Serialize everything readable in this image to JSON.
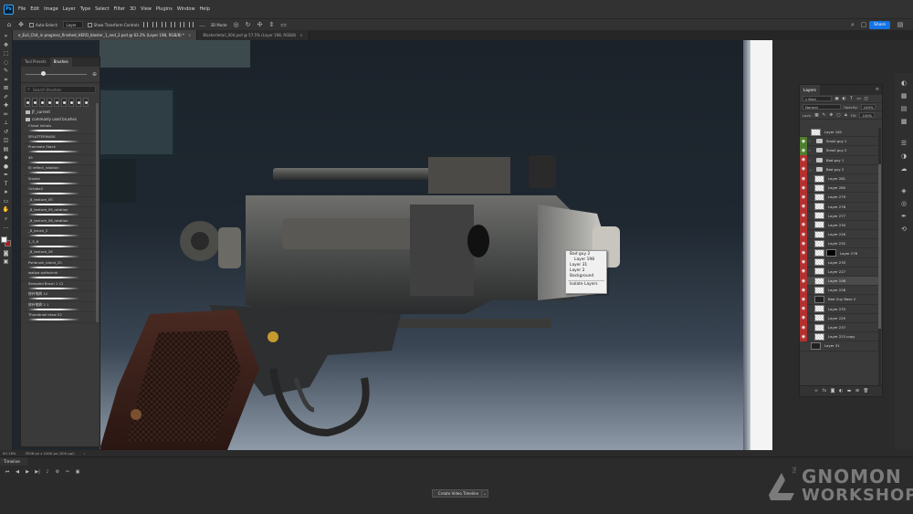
{
  "menubar": {
    "logo": "Ps",
    "items": [
      "File",
      "Edit",
      "Image",
      "Layer",
      "Type",
      "Select",
      "Filter",
      "3D",
      "View",
      "Plugins",
      "Window",
      "Help"
    ]
  },
  "options": {
    "auto_select_label": "Auto-Select:",
    "auto_select_value": "Layer",
    "transform_controls_label": "Show Transform Controls",
    "mode_3d_label": "3D Mode:",
    "share_label": "Share"
  },
  "tabs": [
    {
      "label": "e_Evil_Chit_in progress_finished_HERO_blaster_1_and_2.psd @ 63.2% (Layer 198, RGB/8) *",
      "active": true
    },
    {
      "label": "Blasterdetail_004.psd @ 57.5% (Layer 198, RGB/8)",
      "active": false
    }
  ],
  "brush_panel": {
    "tabs": [
      "Tool Presets",
      "Brushes"
    ],
    "search_placeholder": "Search Brushes",
    "folders": [
      "JF_current",
      "commonly used brushes"
    ],
    "brushes": [
      "Chisel Initials",
      "SPLATTERMASK",
      "Procreate Stack",
      "45",
      "EJ reflect_rotation",
      "Smoke",
      "Octoball",
      "_8_texture_05",
      "_8_texture_09_rotation",
      "_8_texture_06_rotation",
      "_8_brush_2",
      "1_5_8",
      "_8_texture_26",
      "Pshbrush_blend_20",
      "wallpa auftschnk",
      "Sampled Brush 1 12",
      "修补笔刷 12",
      "修补笔刷 2 1",
      "Thumbnail draw 02"
    ]
  },
  "context_menu": {
    "items": [
      "Bad guy 2",
      "Layer 198",
      "Layer 31",
      "Layer 2",
      "Background"
    ],
    "isolate_label": "Isolate Layers"
  },
  "layers_panel": {
    "tab_label": "Layers",
    "kind_label": "Kind",
    "blend_mode": "Normal",
    "opacity_label": "Opacity:",
    "opacity_value": "100%",
    "lock_label": "Lock:",
    "fill_label": "Fill:",
    "fill_value": "100%",
    "layers": [
      {
        "name": "Layer 162",
        "vis": "none",
        "kind": "layer",
        "indent": 0
      },
      {
        "name": "Small guy 1",
        "vis": "green",
        "kind": "folder",
        "indent": 0
      },
      {
        "name": "Small guy 2",
        "vis": "green",
        "kind": "folder",
        "indent": 0
      },
      {
        "name": "Bad guy 1",
        "vis": "red",
        "kind": "folder",
        "indent": 0
      },
      {
        "name": "Bad guy 2",
        "vis": "red",
        "kind": "folder",
        "indent": 0,
        "open": true
      },
      {
        "name": "Layer 281",
        "vis": "red",
        "kind": "layer",
        "indent": 1
      },
      {
        "name": "Layer 280",
        "vis": "red",
        "kind": "layer",
        "indent": 1
      },
      {
        "name": "Layer 279",
        "vis": "red",
        "kind": "layer",
        "indent": 1
      },
      {
        "name": "Layer 278",
        "vis": "red",
        "kind": "layer",
        "indent": 1
      },
      {
        "name": "Layer 277",
        "vis": "red",
        "kind": "layer",
        "indent": 1
      },
      {
        "name": "Layer 230",
        "vis": "red",
        "kind": "layer",
        "indent": 1
      },
      {
        "name": "Layer 226",
        "vis": "red",
        "kind": "layer",
        "indent": 1
      },
      {
        "name": "Layer 232",
        "vis": "red",
        "kind": "layer",
        "indent": 1
      },
      {
        "name": "Layer 278",
        "vis": "red",
        "kind": "mask",
        "indent": 1
      },
      {
        "name": "Layer 235",
        "vis": "red",
        "kind": "layer",
        "indent": 1
      },
      {
        "name": "Layer 227",
        "vis": "red",
        "kind": "layer",
        "indent": 1
      },
      {
        "name": "Layer 198",
        "vis": "red",
        "kind": "layer",
        "indent": 1,
        "selected": true
      },
      {
        "name": "Layer 228",
        "vis": "red",
        "kind": "layer",
        "indent": 1
      },
      {
        "name": "Bad Guy Base 2",
        "vis": "red",
        "kind": "dark",
        "indent": 1
      },
      {
        "name": "Layer 233",
        "vis": "red",
        "kind": "layer",
        "indent": 1
      },
      {
        "name": "Layer 229",
        "vis": "red",
        "kind": "layer",
        "indent": 1
      },
      {
        "name": "Layer 237",
        "vis": "red",
        "kind": "layer",
        "indent": 1
      },
      {
        "name": "Layer 223 copy",
        "vis": "red",
        "kind": "layer",
        "indent": 1
      },
      {
        "name": "Layer 31",
        "vis": "none",
        "kind": "dark",
        "indent": 0
      }
    ]
  },
  "statusbar": {
    "zoom": "63.18%",
    "doc_size": "3556 px x 2400 px (300 ppi)"
  },
  "timeline": {
    "title": "Timeline",
    "create_label": "Create Video Timeline"
  },
  "watermark": {
    "the": "THE",
    "line1": "GNOMON",
    "line2": "WORKSHOP"
  },
  "colors": {
    "accent": "#1473e6",
    "foreground_swatch": "#f2f2f2",
    "background_swatch": "#b01a1a",
    "layer_vis_red": "#b3302f",
    "layer_vis_green": "#4f7d2e"
  }
}
